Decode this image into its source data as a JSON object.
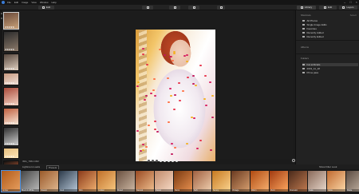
{
  "menubar": {
    "items": [
      "File",
      "Edit",
      "Image",
      "View",
      "Window",
      "Help"
    ],
    "window_controls": [
      "–",
      "□",
      "×"
    ]
  },
  "toolbar": {
    "left_button": "Edit",
    "right_tabs": [
      "Library",
      "Edit",
      "Layers"
    ]
  },
  "sidebar": {
    "shortcuts_label": "Shortcuts",
    "shortcuts_action": "Select",
    "shortcuts": [
      {
        "label": "All Photos",
        "icon": "photos-icon"
      },
      {
        "label": "Single Image Edits",
        "icon": "single-edit-icon"
      },
      {
        "label": "Favorites",
        "icon": "heart-icon"
      },
      {
        "label": "Recently Added",
        "icon": "clock-icon"
      },
      {
        "label": "Recently Edited",
        "icon": "pencil-icon"
      }
    ],
    "albums_label": "Albums",
    "folders_label": "Folders",
    "folders": [
      {
        "label": "Fat artificials",
        "active": true
      },
      {
        "label": "2019_11_18",
        "active": false
      },
      {
        "label": "Prime jaws",
        "active": false
      }
    ]
  },
  "thumbnails": [
    {
      "stars": "★★★★★",
      "colors": [
        "#6a4a3a",
        "#c9a27a"
      ]
    },
    {
      "stars": "★★★★★",
      "colors": [
        "#2c2c2c",
        "#8c7a6a"
      ]
    },
    {
      "stars": "★★★★★",
      "colors": [
        "#5a4a40",
        "#e0d0c0"
      ]
    },
    {
      "stars": "★★★★★",
      "colors": [
        "#c89a80",
        "#f0e0d8"
      ]
    },
    {
      "stars": "★★★★★",
      "colors": [
        "#aa4a3a",
        "#f4d4c4"
      ]
    },
    {
      "stars": "★★★★★",
      "colors": [
        "#c06040",
        "#f8e8d8"
      ]
    },
    {
      "stars": "★★★★★",
      "colors": [
        "#303030",
        "#d0d0d0"
      ]
    },
    {
      "stars": "★★★★★",
      "colors": [
        "#e8c080",
        "#fbe4b8"
      ]
    },
    {
      "stars": "",
      "colors": [
        "#111111",
        "#aa5533"
      ]
    }
  ],
  "photo": {
    "page_dots": 8,
    "current_dot": 3
  },
  "bottom_info": "IMG_7964.CR2",
  "filters": {
    "tabs": [
      "Lightroom Looks",
      "Presets"
    ],
    "right_action": "Show Filter Look"
  },
  "filmstrip": [
    {
      "label": "Amber",
      "colors": [
        "#b05a1a",
        "#e8a060"
      ]
    },
    {
      "label": "Black & White",
      "colors": [
        "#444444",
        "#bbbbbb"
      ]
    },
    {
      "label": "Classic",
      "colors": [
        "#9a5a2a",
        "#e0b890"
      ]
    },
    {
      "label": "Cool",
      "colors": [
        "#2c3a4a",
        "#b8c8d8"
      ]
    },
    {
      "label": "Film",
      "colors": [
        "#8a3a1a",
        "#f0b070"
      ]
    },
    {
      "label": "Golden",
      "colors": [
        "#c0702a",
        "#f8c880"
      ]
    },
    {
      "label": "Muted",
      "colors": [
        "#6a5040",
        "#cdb8a4"
      ]
    },
    {
      "label": "Natural",
      "colors": [
        "#9a4a22",
        "#f0c090"
      ]
    },
    {
      "label": "Pastel",
      "colors": [
        "#c08a6a",
        "#f8dcc8"
      ]
    },
    {
      "label": "Retro",
      "colors": [
        "#7a3a10",
        "#e89050"
      ]
    },
    {
      "label": "Soft",
      "colors": [
        "#a06040",
        "#f0d0b0"
      ]
    },
    {
      "label": "Sunny",
      "colors": [
        "#c87a20",
        "#fad490"
      ]
    },
    {
      "label": "Vintage",
      "colors": [
        "#6a3a20",
        "#d8a070"
      ]
    },
    {
      "label": "Warm",
      "colors": [
        "#b04a10",
        "#f8b070"
      ]
    },
    {
      "label": "Vivid",
      "colors": [
        "#a03a10",
        "#ffa860"
      ]
    },
    {
      "label": "Dramatic",
      "colors": [
        "#4a2a1a",
        "#c07a50"
      ]
    },
    {
      "label": "Fade",
      "colors": [
        "#8a6a5a",
        "#e8d8cc"
      ]
    },
    {
      "label": "Glow",
      "colors": [
        "#c06a30",
        "#fcd8a8"
      ]
    },
    {
      "label": "Matte",
      "colors": [
        "#5a4a40",
        "#c8b8a8"
      ]
    }
  ]
}
